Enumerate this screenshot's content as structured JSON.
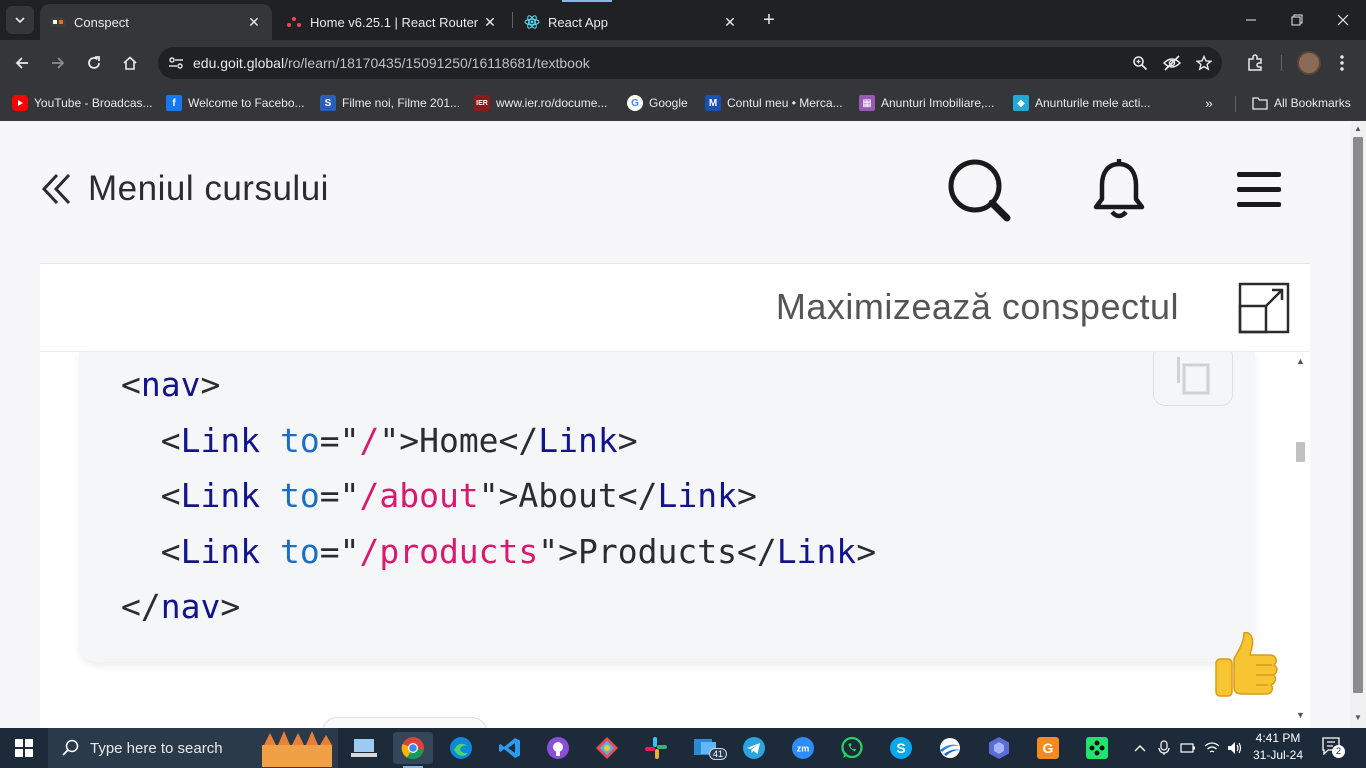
{
  "browser": {
    "tabs": [
      {
        "title": "Conspect",
        "active": true
      },
      {
        "title": "Home v6.25.1 | React Router",
        "active": false
      },
      {
        "title": "React App",
        "active": false
      }
    ],
    "url_host": "edu.goit.global",
    "url_path": "/ro/learn/18170435/15091250/16118681/textbook",
    "bookmarks": [
      {
        "label": "YouTube - Broadcas...",
        "icon": "youtube-icon",
        "color": "#ff0000"
      },
      {
        "label": "Welcome to Facebo...",
        "icon": "facebook-icon",
        "color": "#1877f2"
      },
      {
        "label": "Filme noi, Filme 201...",
        "icon": "s-site-icon",
        "color": "#2b5fb4"
      },
      {
        "label": "www.ier.ro/docume...",
        "icon": "ier-icon",
        "color": "#8b1a1a"
      },
      {
        "label": "Google",
        "icon": "google-icon",
        "color": "#ffffff"
      },
      {
        "label": "Contul meu • Merca...",
        "icon": "mercado-icon",
        "color": "#1a4fb4"
      },
      {
        "label": "Anunturi Imobiliare,...",
        "icon": "imobiliare-icon",
        "color": "#9b59b6"
      },
      {
        "label": "Anunturile mele acti...",
        "icon": "olx-icon",
        "color": "#23a9d8"
      }
    ],
    "bookmarks_overflow": "»",
    "all_bookmarks": "All Bookmarks"
  },
  "page": {
    "menu_label": "Meniul cursului",
    "maximize_label": "Maximizează conspectul",
    "code_lines": [
      [
        {
          "t": "<",
          "c": "p"
        },
        {
          "t": "nav",
          "c": "tag"
        },
        {
          "t": ">",
          "c": "p"
        }
      ],
      [
        {
          "t": "  <",
          "c": "p"
        },
        {
          "t": "Link",
          "c": "tag"
        },
        {
          "t": " ",
          "c": "p"
        },
        {
          "t": "to",
          "c": "attr"
        },
        {
          "t": "=\"",
          "c": "p"
        },
        {
          "t": "/",
          "c": "str"
        },
        {
          "t": "\">Home</",
          "c": "p"
        },
        {
          "t": "Link",
          "c": "tag"
        },
        {
          "t": ">",
          "c": "p"
        }
      ],
      [
        {
          "t": "  <",
          "c": "p"
        },
        {
          "t": "Link",
          "c": "tag"
        },
        {
          "t": " ",
          "c": "p"
        },
        {
          "t": "to",
          "c": "attr"
        },
        {
          "t": "=\"",
          "c": "p"
        },
        {
          "t": "/about",
          "c": "str"
        },
        {
          "t": "\">About</",
          "c": "p"
        },
        {
          "t": "Link",
          "c": "tag"
        },
        {
          "t": ">",
          "c": "p"
        }
      ],
      [
        {
          "t": "  <",
          "c": "p"
        },
        {
          "t": "Link",
          "c": "tag"
        },
        {
          "t": " ",
          "c": "p"
        },
        {
          "t": "to",
          "c": "attr"
        },
        {
          "t": "=\"",
          "c": "p"
        },
        {
          "t": "/products",
          "c": "str"
        },
        {
          "t": "\">Products</",
          "c": "p"
        },
        {
          "t": "Link",
          "c": "tag"
        },
        {
          "t": ">",
          "c": "p"
        }
      ],
      [
        {
          "t": "</",
          "c": "p"
        },
        {
          "t": "nav",
          "c": "tag"
        },
        {
          "t": ">",
          "c": "p"
        }
      ]
    ]
  },
  "taskbar": {
    "search_placeholder": "Type here to search",
    "outlook_badge": "41",
    "time": "4:41 PM",
    "date": "31-Jul-24",
    "notification_count": "2"
  },
  "colors": {
    "code_tag": "#14148a",
    "code_attr": "#1a6fc4",
    "code_string": "#d8196e",
    "chrome_dark": "#35363a",
    "taskbar": "#1c2a3a"
  }
}
